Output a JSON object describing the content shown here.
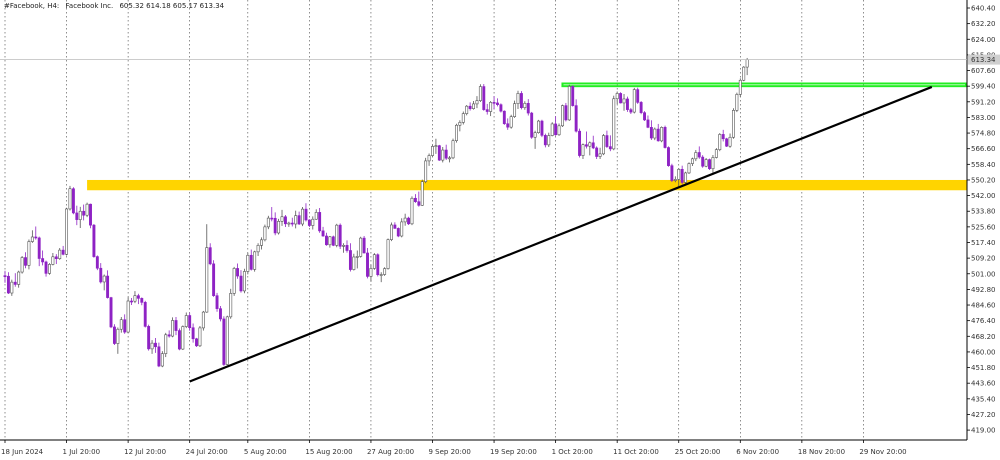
{
  "header": {
    "symbol": "#Facebook, H4:",
    "name": "Facebook Inc.",
    "ohlc": "605.32 614.18 605.17 613.34"
  },
  "colors": {
    "bull": "#ffffff",
    "bull_border": "#555555",
    "bear": "#8e22c4",
    "zone_yellow": "#ffd400",
    "zone_green": "#22ee22",
    "trendline": "#000000",
    "grid": "#444444"
  },
  "icons": [
    "price-label-arrow-icon"
  ],
  "chart_data": {
    "type": "candlestick",
    "ylim": [
      413.8,
      644.6
    ],
    "grid": "vertical-dotted",
    "y_ticks": [
      "640.40",
      "632.20",
      "624.00",
      "615.80",
      "607.60",
      "599.40",
      "591.20",
      "583.00",
      "574.80",
      "566.60",
      "558.40",
      "550.20",
      "542.00",
      "533.80",
      "525.60",
      "517.40",
      "509.20",
      "501.00",
      "492.80",
      "484.60",
      "476.40",
      "468.20",
      "460.00",
      "451.80",
      "443.60",
      "435.40",
      "427.20",
      "419.00"
    ],
    "x_ticks": [
      {
        "label": "18 Jun 2024",
        "index": 0
      },
      {
        "label": "1 Jul 20:00",
        "index": 18
      },
      {
        "label": "12 Jul 20:00",
        "index": 36
      },
      {
        "label": "24 Jul 20:00",
        "index": 54
      },
      {
        "label": "5 Aug 20:00",
        "index": 71
      },
      {
        "label": "15 Aug 20:00",
        "index": 89
      },
      {
        "label": "27 Aug 20:00",
        "index": 107
      },
      {
        "label": "9 Sep 20:00",
        "index": 125
      },
      {
        "label": "19 Sep 20:00",
        "index": 143
      },
      {
        "label": "1 Oct 20:00",
        "index": 161
      },
      {
        "label": "11 Oct 20:00",
        "index": 179
      },
      {
        "label": "25 Oct 20:00",
        "index": 197
      },
      {
        "label": "6 Nov 20:00",
        "index": 215
      },
      {
        "label": "18 Nov 20:00",
        "index": 233
      },
      {
        "label": "29 Nov 20:00",
        "index": 251
      }
    ],
    "current_price": 613.34,
    "current_price_label": "613.34",
    "support_zone": [
      544.8,
      550.2
    ],
    "resistance_zone": [
      599.4,
      600.8
    ],
    "trendline": [
      {
        "index": 54,
        "price": 444.5
      },
      {
        "index": 271,
        "price": 599.0
      }
    ],
    "candles": [
      [
        500.0,
        502.6,
        496.3,
        499.7
      ],
      [
        499.7,
        501.8,
        490.4,
        490.9
      ],
      [
        490.9,
        497.9,
        489.4,
        496.6
      ],
      [
        496.6,
        501.3,
        494.2,
        495.4
      ],
      [
        495.4,
        502.6,
        493.7,
        501.9
      ],
      [
        501.9,
        510.3,
        501.1,
        509.5
      ],
      [
        509.5,
        512.3,
        503.9,
        505.4
      ],
      [
        505.4,
        519.0,
        503.3,
        517.9
      ],
      [
        517.9,
        523.8,
        517.2,
        520.3
      ],
      [
        520.3,
        525.8,
        518.9,
        519.8
      ],
      [
        519.8,
        520.5,
        505.0,
        509.0
      ],
      [
        509.0,
        513.2,
        505.4,
        507.2
      ],
      [
        507.2,
        507.9,
        499.5,
        501.2
      ],
      [
        501.2,
        506.6,
        500.5,
        505.9
      ],
      [
        505.9,
        511.9,
        505.4,
        509.9
      ],
      [
        509.9,
        511.3,
        506.1,
        508.9
      ],
      [
        508.9,
        514.5,
        508.3,
        513.4
      ],
      [
        513.4,
        515.6,
        510.7,
        511.2
      ],
      [
        511.2,
        535.6,
        510.6,
        535.0
      ],
      [
        535.0,
        547.1,
        534.2,
        545.6
      ],
      [
        545.6,
        546.4,
        532.2,
        532.9
      ],
      [
        532.9,
        536.7,
        526.5,
        529.4
      ],
      [
        529.4,
        536.1,
        525.0,
        533.8
      ],
      [
        533.8,
        537.3,
        529.0,
        531.7
      ],
      [
        531.7,
        538.3,
        530.7,
        537.5
      ],
      [
        537.5,
        537.8,
        524.9,
        526.5
      ],
      [
        526.5,
        527.1,
        509.4,
        510.0
      ],
      [
        510.0,
        510.6,
        502.9,
        503.9
      ],
      [
        503.9,
        506.6,
        495.9,
        496.7
      ],
      [
        496.7,
        500.6,
        492.3,
        499.8
      ],
      [
        499.8,
        502.8,
        488.0,
        488.5
      ],
      [
        488.5,
        488.9,
        472.5,
        473.1
      ],
      [
        473.1,
        474.5,
        463.6,
        464.4
      ],
      [
        464.4,
        472.8,
        459.0,
        471.9
      ],
      [
        471.9,
        478.3,
        470.1,
        476.9
      ],
      [
        476.9,
        479.7,
        469.5,
        470.4
      ],
      [
        470.4,
        488.6,
        469.8,
        486.7
      ],
      [
        486.7,
        488.3,
        484.6,
        486.6
      ],
      [
        486.6,
        491.9,
        485.6,
        489.5
      ],
      [
        489.5,
        490.5,
        485.1,
        488.1
      ],
      [
        488.1,
        488.6,
        484.5,
        486.0
      ],
      [
        486.0,
        486.8,
        472.8,
        473.4
      ],
      [
        473.4,
        474.3,
        460.7,
        461.6
      ],
      [
        461.6,
        466.2,
        459.0,
        464.6
      ],
      [
        464.6,
        467.3,
        459.5,
        462.7
      ],
      [
        462.7,
        464.9,
        452.0,
        452.6
      ],
      [
        452.6,
        460.4,
        452.0,
        459.1
      ],
      [
        459.1,
        470.0,
        457.3,
        469.0
      ],
      [
        469.0,
        471.3,
        467.5,
        468.3
      ],
      [
        468.3,
        478.1,
        467.7,
        476.5
      ],
      [
        476.5,
        478.3,
        468.8,
        471.2
      ],
      [
        471.2,
        472.3,
        460.9,
        461.5
      ],
      [
        461.5,
        473.9,
        461.0,
        473.3
      ],
      [
        473.3,
        480.7,
        472.5,
        479.1
      ],
      [
        479.1,
        480.5,
        471.1,
        472.7
      ],
      [
        472.7,
        474.9,
        464.9,
        466.9
      ],
      [
        466.9,
        467.4,
        462.6,
        463.2
      ],
      [
        463.2,
        473.6,
        462.6,
        472.6
      ],
      [
        472.6,
        481.5,
        471.2,
        480.9
      ],
      [
        480.9,
        527.0,
        480.5,
        514.7
      ],
      [
        514.7,
        517.0,
        505.5,
        506.2
      ],
      [
        506.2,
        508.1,
        488.9,
        489.5
      ],
      [
        489.5,
        491.0,
        481.1,
        482.7
      ],
      [
        482.7,
        484.1,
        476.0,
        477.3
      ],
      [
        477.3,
        478.7,
        452.7,
        453.4
      ],
      [
        453.4,
        479.0,
        453.0,
        478.4
      ],
      [
        478.4,
        493.1,
        477.4,
        490.7
      ],
      [
        490.7,
        504.6,
        489.4,
        503.8
      ],
      [
        503.8,
        506.4,
        498.4,
        499.8
      ],
      [
        499.8,
        502.9,
        491.1,
        492.0
      ],
      [
        492.0,
        503.6,
        490.8,
        502.2
      ],
      [
        502.2,
        511.9,
        500.7,
        510.7
      ],
      [
        510.7,
        513.7,
        502.7,
        503.3
      ],
      [
        503.3,
        513.1,
        502.1,
        512.5
      ],
      [
        512.5,
        517.0,
        510.3,
        515.9
      ],
      [
        515.9,
        520.1,
        513.7,
        518.8
      ],
      [
        518.8,
        526.8,
        518.0,
        525.6
      ],
      [
        525.6,
        531.4,
        524.4,
        530.2
      ],
      [
        530.2,
        536.0,
        528.5,
        530.1
      ],
      [
        530.1,
        533.2,
        521.2,
        522.4
      ],
      [
        522.4,
        529.8,
        521.6,
        528.5
      ],
      [
        528.5,
        534.5,
        526.1,
        530.9
      ],
      [
        530.9,
        531.8,
        525.5,
        527.2
      ],
      [
        527.2,
        528.3,
        525.6,
        527.6
      ],
      [
        527.6,
        530.4,
        525.8,
        527.1
      ],
      [
        527.1,
        534.1,
        524.8,
        531.5
      ],
      [
        531.5,
        533.6,
        526.6,
        527.1
      ],
      [
        527.1,
        536.0,
        526.0,
        534.9
      ],
      [
        534.9,
        538.0,
        528.4,
        529.2
      ],
      [
        529.2,
        529.6,
        525.5,
        526.3
      ],
      [
        526.3,
        531.1,
        524.2,
        529.6
      ],
      [
        529.6,
        534.8,
        529.3,
        533.2
      ],
      [
        533.2,
        535.5,
        522.5,
        523.5
      ],
      [
        523.5,
        525.6,
        520.4,
        520.8
      ],
      [
        520.8,
        522.5,
        515.7,
        516.2
      ],
      [
        516.2,
        520.8,
        514.7,
        520.4
      ],
      [
        520.4,
        521.0,
        515.5,
        515.9
      ],
      [
        515.9,
        527.2,
        514.9,
        526.5
      ],
      [
        526.5,
        527.4,
        514.0,
        515.4
      ],
      [
        515.4,
        517.0,
        512.0,
        515.9
      ],
      [
        515.9,
        518.5,
        512.1,
        513.2
      ],
      [
        513.2,
        517.0,
        502.2,
        503.2
      ],
      [
        503.2,
        511.5,
        502.7,
        509.8
      ],
      [
        509.8,
        513.2,
        503.8,
        510.1
      ],
      [
        510.1,
        520.4,
        509.5,
        519.7
      ],
      [
        519.7,
        520.8,
        511.6,
        511.9
      ],
      [
        511.9,
        514.5,
        498.6,
        499.6
      ],
      [
        499.6,
        505.5,
        496.8,
        503.8
      ],
      [
        503.8,
        511.8,
        503.1,
        511.0
      ],
      [
        511.0,
        511.7,
        499.6,
        500.5
      ],
      [
        500.5,
        501.8,
        496.6,
        500.6
      ],
      [
        500.6,
        504.4,
        499.9,
        503.7
      ],
      [
        503.7,
        519.5,
        503.2,
        518.9
      ],
      [
        518.9,
        527.9,
        518.1,
        526.6
      ],
      [
        526.6,
        528.0,
        524.6,
        524.8
      ],
      [
        524.8,
        525.3,
        520.2,
        520.8
      ],
      [
        520.8,
        530.1,
        520.1,
        528.2
      ],
      [
        528.2,
        532.5,
        526.2,
        530.2
      ],
      [
        530.2,
        530.9,
        526.6,
        527.2
      ],
      [
        527.2,
        541.6,
        526.5,
        540.6
      ],
      [
        540.6,
        542.8,
        538.2,
        538.8
      ],
      [
        538.8,
        544.1,
        536.2,
        536.9
      ],
      [
        536.9,
        550.4,
        536.6,
        549.3
      ],
      [
        549.3,
        561.8,
        548.5,
        560.2
      ],
      [
        560.2,
        564.1,
        557.6,
        563.0
      ],
      [
        563.0,
        568.4,
        562.5,
        567.8
      ],
      [
        567.8,
        571.8,
        563.9,
        568.2
      ],
      [
        568.2,
        568.6,
        560.2,
        560.6
      ],
      [
        560.6,
        567.5,
        559.4,
        565.9
      ],
      [
        565.9,
        568.7,
        560.7,
        561.6
      ],
      [
        561.6,
        562.8,
        559.4,
        561.8
      ],
      [
        561.8,
        571.9,
        561.1,
        570.8
      ],
      [
        570.8,
        579.7,
        569.8,
        578.9
      ],
      [
        578.9,
        581.5,
        575.7,
        580.4
      ],
      [
        580.4,
        586.1,
        579.3,
        585.0
      ],
      [
        585.0,
        589.5,
        584.1,
        588.9
      ],
      [
        588.9,
        590.9,
        586.6,
        587.6
      ],
      [
        587.6,
        591.6,
        587.1,
        590.1
      ],
      [
        590.1,
        594.2,
        587.9,
        591.8
      ],
      [
        591.8,
        600.4,
        591.1,
        599.2
      ],
      [
        599.2,
        600.5,
        586.5,
        587.1
      ],
      [
        587.1,
        590.1,
        584.5,
        586.1
      ],
      [
        586.1,
        591.6,
        583.7,
        590.9
      ],
      [
        590.9,
        594.1,
        587.3,
        590.6
      ],
      [
        590.6,
        593.0,
        588.8,
        589.7
      ],
      [
        589.7,
        590.4,
        585.6,
        586.3
      ],
      [
        586.3,
        586.7,
        579.1,
        579.7
      ],
      [
        579.7,
        582.5,
        576.5,
        577.9
      ],
      [
        577.9,
        584.4,
        577.1,
        583.4
      ],
      [
        583.4,
        591.8,
        582.8,
        590.2
      ],
      [
        590.2,
        597.0,
        587.4,
        595.6
      ],
      [
        595.6,
        596.8,
        587.2,
        588.1
      ],
      [
        588.1,
        591.5,
        587.0,
        590.4
      ],
      [
        590.4,
        592.6,
        584.0,
        585.3
      ],
      [
        585.3,
        585.9,
        571.8,
        572.6
      ],
      [
        572.6,
        576.0,
        566.5,
        575.0
      ],
      [
        575.0,
        581.7,
        574.5,
        581.1
      ],
      [
        581.1,
        581.8,
        572.7,
        573.6
      ],
      [
        573.6,
        574.5,
        567.3,
        568.6
      ],
      [
        568.6,
        575.0,
        567.5,
        573.5
      ],
      [
        573.5,
        580.5,
        573.1,
        579.6
      ],
      [
        579.6,
        583.6,
        573.4,
        573.9
      ],
      [
        573.9,
        579.8,
        573.3,
        578.6
      ],
      [
        578.6,
        589.7,
        578.0,
        589.2
      ],
      [
        589.2,
        590.6,
        580.9,
        581.7
      ],
      [
        581.7,
        600.1,
        581.2,
        599.3
      ],
      [
        599.3,
        599.8,
        588.7,
        589.2
      ],
      [
        589.2,
        592.5,
        575.1,
        575.8
      ],
      [
        575.8,
        577.1,
        562.0,
        563.0
      ],
      [
        563.0,
        569.3,
        561.2,
        568.7
      ],
      [
        568.7,
        575.6,
        566.7,
        567.9
      ],
      [
        567.9,
        570.4,
        563.1,
        569.7
      ],
      [
        569.7,
        573.4,
        566.4,
        567.0
      ],
      [
        567.0,
        567.8,
        561.2,
        562.5
      ],
      [
        562.5,
        567.1,
        561.2,
        563.9
      ],
      [
        563.9,
        574.3,
        563.2,
        573.5
      ],
      [
        573.5,
        576.1,
        567.0,
        567.7
      ],
      [
        567.7,
        573.6,
        565.3,
        566.5
      ],
      [
        566.5,
        594.4,
        565.8,
        592.8
      ],
      [
        592.8,
        596.6,
        590.0,
        595.6
      ],
      [
        595.6,
        596.2,
        590.3,
        590.6
      ],
      [
        590.6,
        595.3,
        586.5,
        592.7
      ],
      [
        592.7,
        593.9,
        585.9,
        587.1
      ],
      [
        587.1,
        588.0,
        584.8,
        585.8
      ],
      [
        585.8,
        598.5,
        585.1,
        597.6
      ],
      [
        597.6,
        598.6,
        590.1,
        590.9
      ],
      [
        590.9,
        591.6,
        584.7,
        585.5
      ],
      [
        585.5,
        586.3,
        581.1,
        581.7
      ],
      [
        581.7,
        584.0,
        577.4,
        577.8
      ],
      [
        577.8,
        581.5,
        571.2,
        572.2
      ],
      [
        572.2,
        577.7,
        571.1,
        576.9
      ],
      [
        576.9,
        579.6,
        570.3,
        570.7
      ],
      [
        570.7,
        578.3,
        570.0,
        577.8
      ],
      [
        577.8,
        578.7,
        566.7,
        567.2
      ],
      [
        567.2,
        567.8,
        557.1,
        557.7
      ],
      [
        557.7,
        558.7,
        549.1,
        549.9
      ],
      [
        549.9,
        552.1,
        549.0,
        550.5
      ],
      [
        550.5,
        556.5,
        546.3,
        555.8
      ],
      [
        555.8,
        557.7,
        547.9,
        548.9
      ],
      [
        548.9,
        554.5,
        548.1,
        553.9
      ],
      [
        553.9,
        559.4,
        553.3,
        558.8
      ],
      [
        558.8,
        561.9,
        557.5,
        561.3
      ],
      [
        561.3,
        565.9,
        560.1,
        564.6
      ],
      [
        564.6,
        567.8,
        561.3,
        562.2
      ],
      [
        562.2,
        563.2,
        556.6,
        557.4
      ],
      [
        557.4,
        561.7,
        556.9,
        560.9
      ],
      [
        560.9,
        561.4,
        555.4,
        556.1
      ],
      [
        556.1,
        563.3,
        552.9,
        562.0
      ],
      [
        562.0,
        566.9,
        561.5,
        566.1
      ],
      [
        566.1,
        574.8,
        565.3,
        574.1
      ],
      [
        574.1,
        576.5,
        570.4,
        571.8
      ],
      [
        571.8,
        572.3,
        567.5,
        567.9
      ],
      [
        567.9,
        574.6,
        567.1,
        572.6
      ],
      [
        572.6,
        587.8,
        571.8,
        586.7
      ],
      [
        586.7,
        596.0,
        585.8,
        595.1
      ],
      [
        595.1,
        603.5,
        593.7,
        602.5
      ],
      [
        602.5,
        609.9,
        602.0,
        609.4
      ],
      [
        609.4,
        614.2,
        605.2,
        613.3
      ]
    ]
  }
}
